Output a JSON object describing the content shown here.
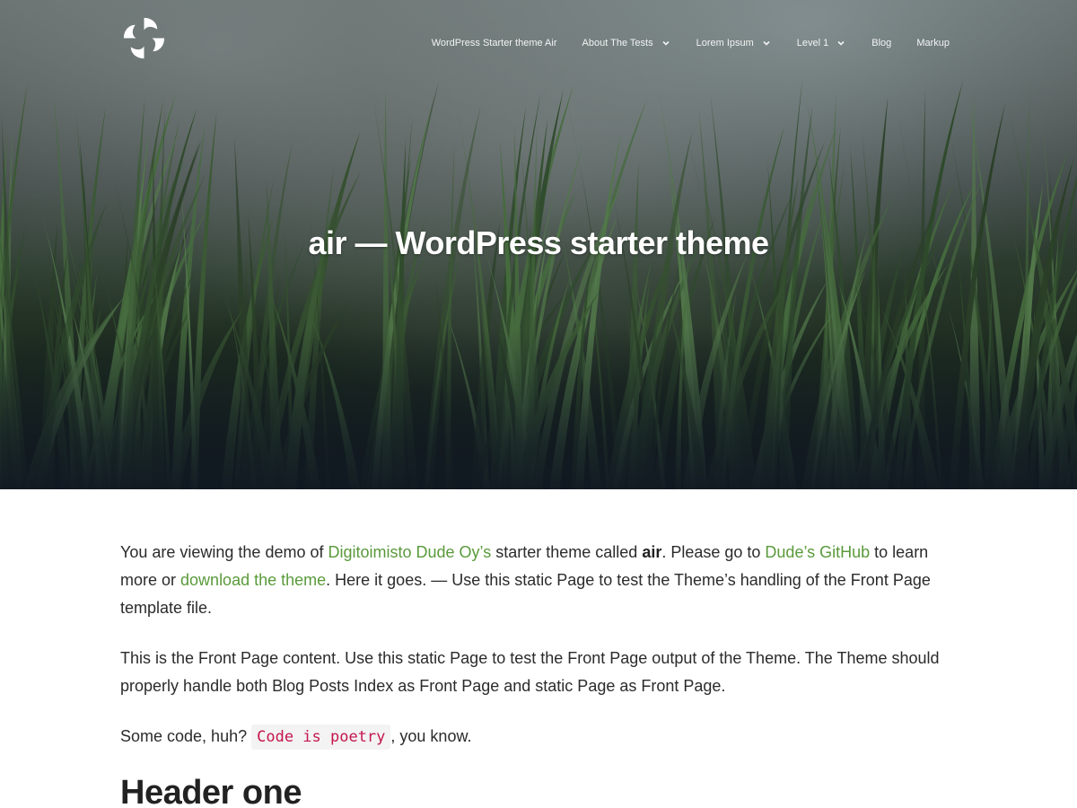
{
  "nav": {
    "items": [
      {
        "label": "WordPress Starter theme Air",
        "has_submenu": false
      },
      {
        "label": "About The Tests",
        "has_submenu": true
      },
      {
        "label": "Lorem Ipsum",
        "has_submenu": true
      },
      {
        "label": "Level 1",
        "has_submenu": true
      },
      {
        "label": "Blog",
        "has_submenu": false
      },
      {
        "label": "Markup",
        "has_submenu": false
      }
    ]
  },
  "hero": {
    "title": "air — WordPress starter theme"
  },
  "content": {
    "p1": {
      "t1": "You are viewing the demo of ",
      "link1": "Digitoimisto Dude Oy’s",
      "t2": " starter theme called ",
      "bold": "air",
      "t3": ". Please go to ",
      "link2": "Dude’s GitHub",
      "t4": " to learn more or ",
      "link3": "download the theme",
      "t5": ". Here it goes. — Use this static Page to test the Theme’s handling of the Front Page template file."
    },
    "p2": "This is the Front Page content. Use this static Page to test the Front Page output of the Theme. The Theme should properly handle both Blog Posts Index as Front Page and static Page as Front Page.",
    "p3": {
      "t1": "Some code, huh? ",
      "code": "Code is poetry",
      "t2": ", you know."
    },
    "heading": "Header one"
  },
  "colors": {
    "link": "#5a9a3b",
    "code": "#c4164c",
    "text": "#2b2b2b"
  },
  "icons": {
    "logo": "swirl-logo-icon",
    "submenu": "chevron-down-icon"
  }
}
